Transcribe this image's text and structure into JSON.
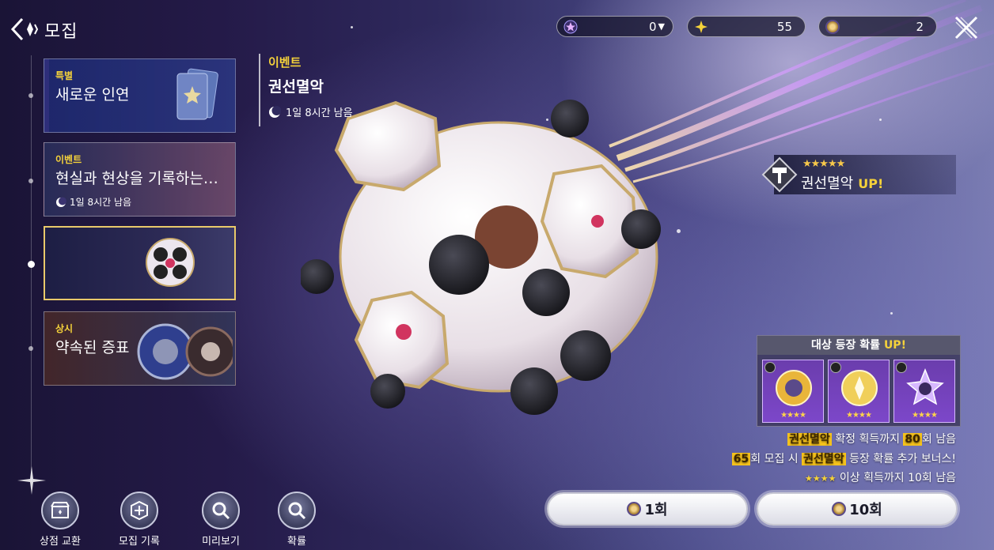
{
  "header": {
    "title": "모집",
    "currencies": [
      {
        "icon": "purple-star-gem-icon",
        "value": "0",
        "has_dropdown": true
      },
      {
        "icon": "gold-sparkle-icon",
        "value": "55"
      },
      {
        "icon": "gold-coin-icon",
        "value": "2"
      }
    ]
  },
  "tabs": [
    {
      "tag": "특별",
      "title": "새로운 인연",
      "timer": ""
    },
    {
      "tag": "이벤트",
      "title": "현실과 현상을 기록하는…",
      "timer": "1일 8시간 남음"
    },
    {
      "tag": "",
      "title": "",
      "timer": ""
    },
    {
      "tag": "상시",
      "title": "약속된 증표",
      "timer": ""
    }
  ],
  "banner": {
    "tag": "이벤트",
    "title": "권선멸악",
    "timer": "1일 8시간 남음"
  },
  "featured": {
    "stars": "★★★★★",
    "name": "권선멸악",
    "up_label": "UP!"
  },
  "rateup": {
    "heading": "대상 등장 확률",
    "up_label": "UP!",
    "cards": [
      {
        "stars": "★★★★"
      },
      {
        "stars": "★★★★"
      },
      {
        "stars": "★★★★"
      }
    ]
  },
  "info": {
    "line1_name": "권선멸악",
    "line1_mid": " 확정 획득까지 ",
    "line1_count": "80",
    "line1_end": "회 남음",
    "line2_count": "65",
    "line2_mid": "회 모집 시 ",
    "line2_name": "권선멸악",
    "line2_end": " 등장 확률 추가 보너스!",
    "line3_stars": "★★★★",
    "line3_text": " 이상 획득까지 10회 남음"
  },
  "pulls": {
    "single_label": "1회",
    "ten_label": "10회"
  },
  "bottom_menu": [
    {
      "icon": "shop-exchange-icon",
      "label": "상점 교환"
    },
    {
      "icon": "recruit-log-icon",
      "label": "모집 기록"
    },
    {
      "icon": "magnifier-icon",
      "label": "미리보기"
    },
    {
      "icon": "magnifier-icon",
      "label": "확률"
    }
  ],
  "colors": {
    "accent_yellow": "#f5d23a",
    "highlight_bg": "#f5c21c",
    "card_purple": "#7c47c9",
    "selected_border": "#e9c96a"
  }
}
